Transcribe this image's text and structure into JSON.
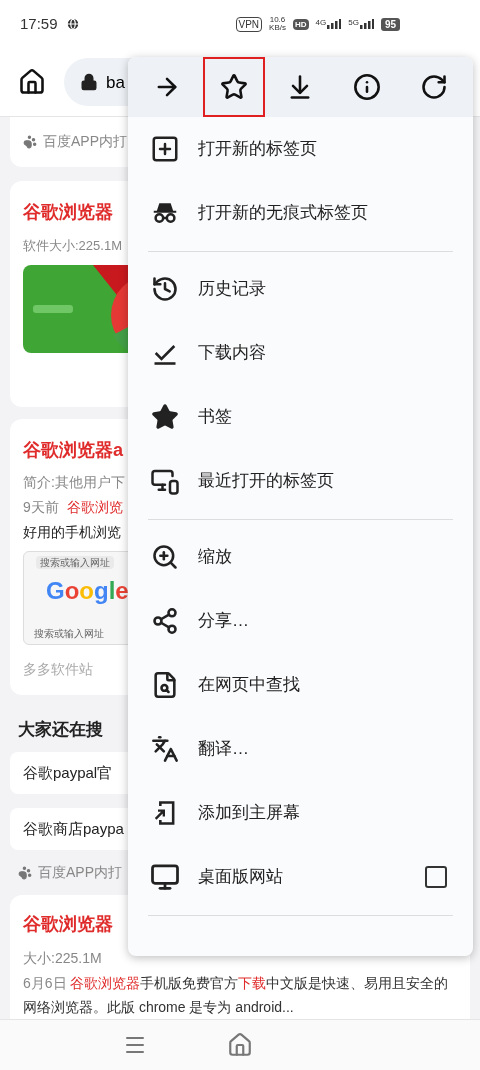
{
  "status_bar": {
    "time": "17:59",
    "vpn": "VPN",
    "speed": {
      "value": "10.6",
      "unit": "KB/s"
    },
    "hd": "HD",
    "signals": [
      {
        "label": "4G"
      },
      {
        "label": "5G"
      }
    ],
    "battery": "95"
  },
  "toolbar": {
    "url": "ba"
  },
  "top_source": {
    "text": "百度APP内打"
  },
  "card1": {
    "title": "谷歌浏览器",
    "meta": "软件大小:225.1M"
  },
  "card2": {
    "title": "谷歌浏览器a",
    "intro": "简介:其他用户下",
    "date": "9天前",
    "link": "谷歌浏览",
    "line": "好用的手机浏览",
    "screenshot": {
      "search_placeholder": "搜索或输入网址",
      "logo": "Google",
      "bottom_placeholder": "搜索或输入网址"
    },
    "source": "多多软件站"
  },
  "searches": {
    "heading": "大家还在搜",
    "chips": [
      "谷歌paypal官",
      "谷歌商店paypa"
    ]
  },
  "source2": {
    "text": "百度APP内打"
  },
  "card3": {
    "title": "谷歌浏览器",
    "meta": "大小:225.1M",
    "snippet": [
      {
        "text": "6月6日 ",
        "kind": "date"
      },
      {
        "text": "谷歌浏览器",
        "kind": "hit"
      },
      {
        "text": "手机版免费官方",
        "kind": "plain"
      },
      {
        "text": "下载",
        "kind": "hit"
      },
      {
        "text": "中文版是快速、易用且安全的网络浏览器。此版 chrome 是专为 android...",
        "kind": "plain"
      }
    ]
  },
  "menu": {
    "actions": [
      {
        "kind": "forward",
        "highlighted": false
      },
      {
        "kind": "bookmark",
        "highlighted": true
      },
      {
        "kind": "download",
        "highlighted": false
      },
      {
        "kind": "info",
        "highlighted": false
      },
      {
        "kind": "reload",
        "highlighted": false
      }
    ],
    "items": [
      {
        "kind": "item",
        "label": "打开新的标签页"
      },
      {
        "kind": "item",
        "label": "打开新的无痕式标签页"
      },
      {
        "kind": "divider"
      },
      {
        "kind": "item",
        "label": "历史记录"
      },
      {
        "kind": "item",
        "label": "下载内容"
      },
      {
        "kind": "item",
        "label": "书签"
      },
      {
        "kind": "item",
        "label": "最近打开的标签页"
      },
      {
        "kind": "divider"
      },
      {
        "kind": "item",
        "label": "缩放"
      },
      {
        "kind": "item",
        "label": "分享…"
      },
      {
        "kind": "item",
        "label": "在网页中查找"
      },
      {
        "kind": "item",
        "label": "翻译…"
      },
      {
        "kind": "item",
        "label": "添加到主屏幕"
      },
      {
        "kind": "check",
        "label": "桌面版网站",
        "checked": false
      },
      {
        "kind": "divider"
      }
    ]
  }
}
